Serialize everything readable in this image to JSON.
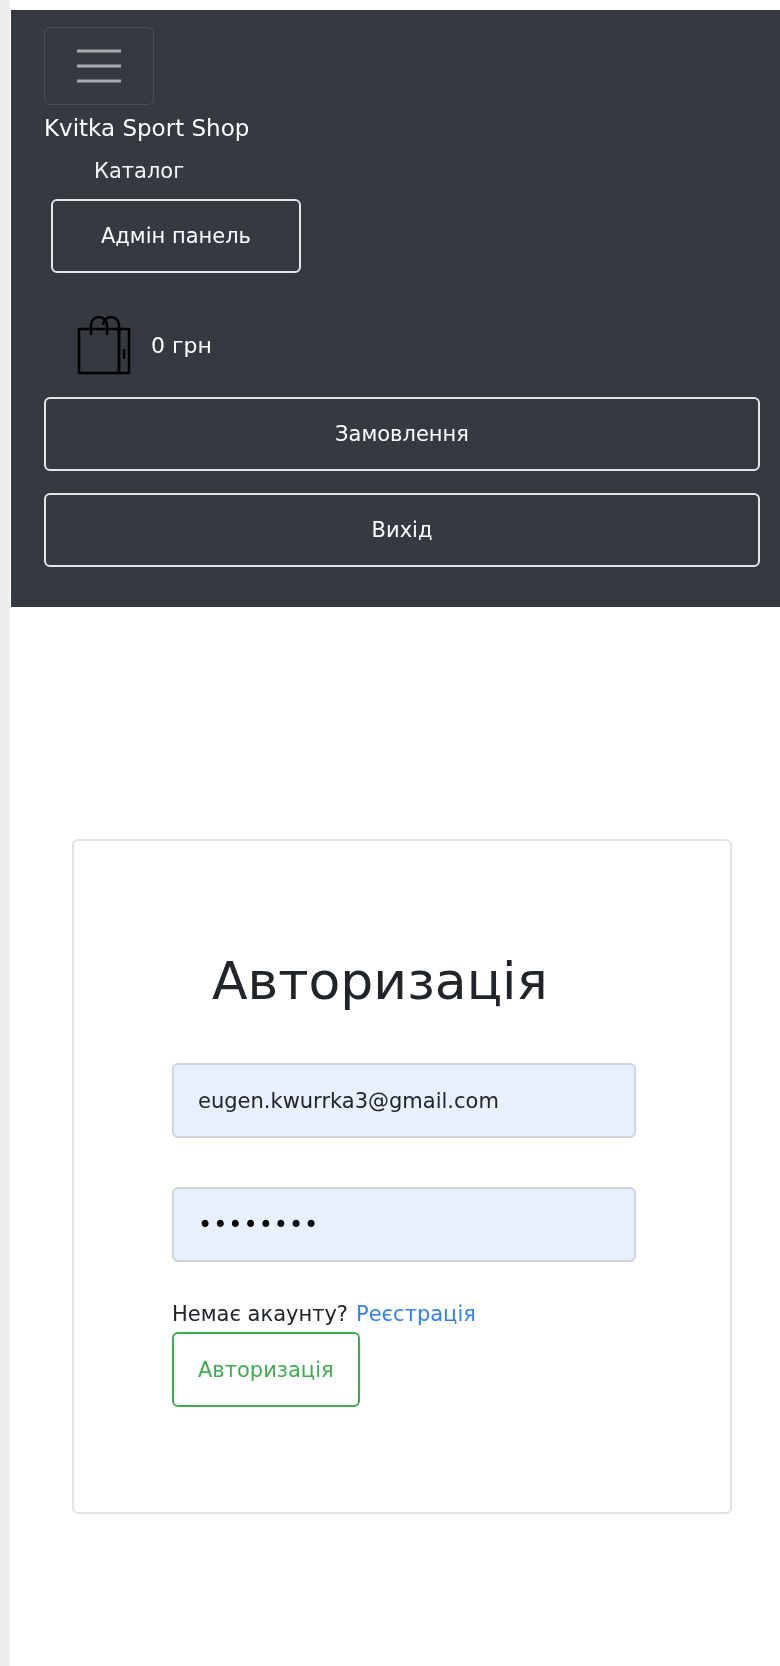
{
  "navbar": {
    "brand": "Kvitka Sport Shop",
    "links": [
      "Каталог"
    ],
    "admin_button": "Адмін панель",
    "cart_total": "0 грн",
    "buttons": [
      "Замовлення",
      "Вихід"
    ]
  },
  "login": {
    "title": "Авторизація",
    "email": {
      "value": "eugen.kwurrka3@gmail.com"
    },
    "password": {
      "value": "••••••••"
    },
    "prompt": "Немає акаунту?",
    "register_link": "Реєстрація",
    "submit": "Авторизація"
  }
}
